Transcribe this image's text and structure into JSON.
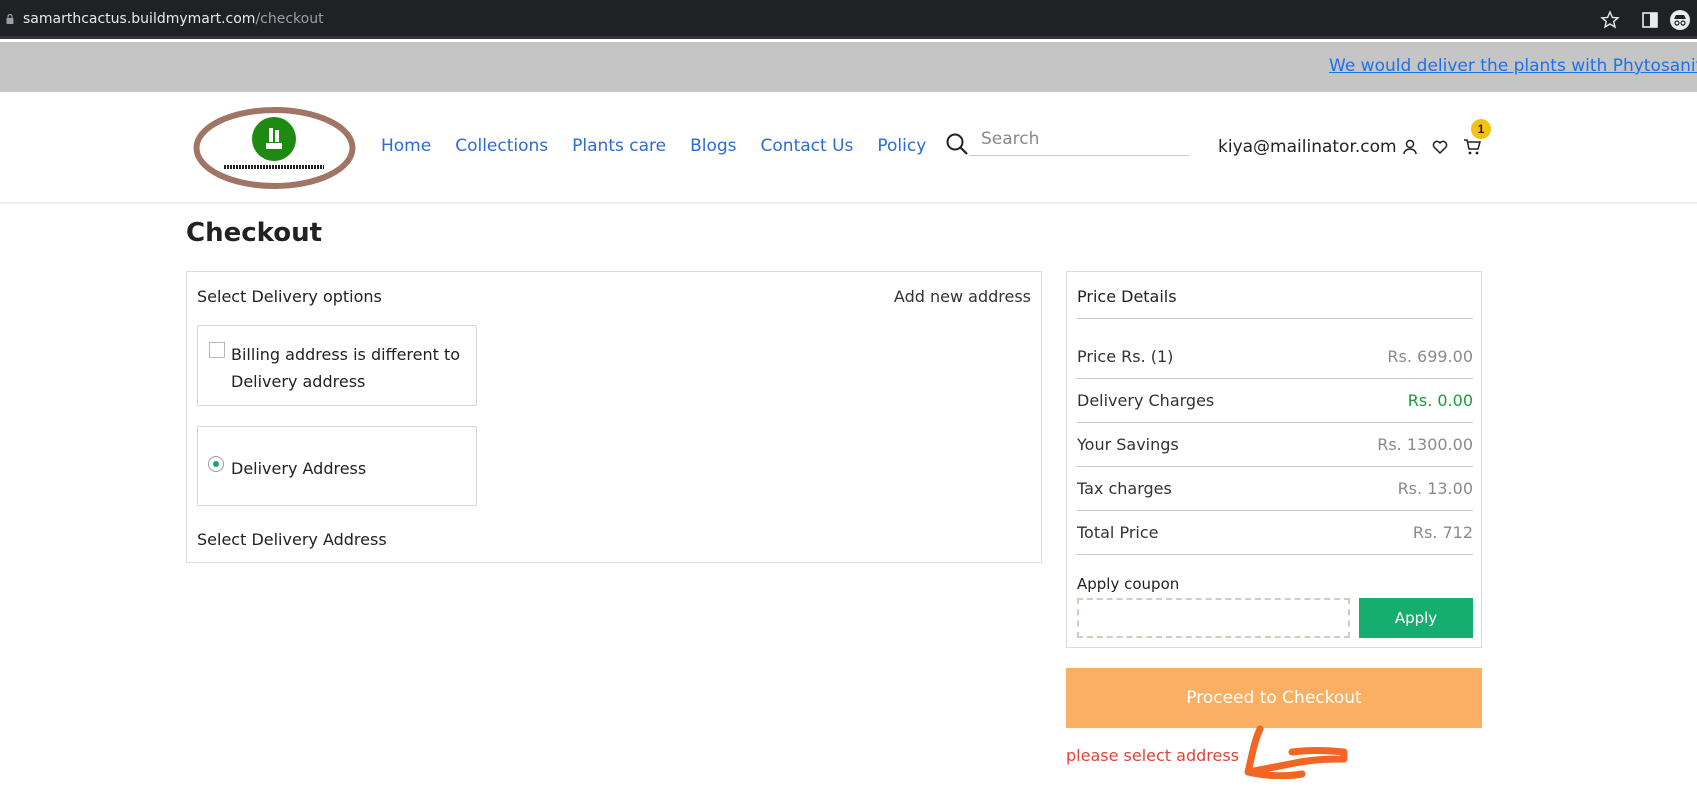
{
  "browser": {
    "url_domain": "samarthcactus.buildmymart.com",
    "url_path": "/checkout"
  },
  "announcement": {
    "text": "We would deliver the plants with Phytosanitary"
  },
  "header": {
    "logo_text": "SAMARTH CACTUS NURSERY",
    "nav": [
      "Home",
      "Collections",
      "Plants care",
      "Blogs",
      "Contact Us",
      "Policy"
    ],
    "search_placeholder": "Search",
    "user_email": "kiya@mailinator.com",
    "cart_count": "1"
  },
  "page": {
    "title": "Checkout"
  },
  "delivery": {
    "title": "Select Delivery options",
    "add_address": "Add new address",
    "billing_option": "Billing address is different to Delivery address",
    "billing_checked": false,
    "delivery_option": "Delivery Address",
    "delivery_selected": true,
    "select_address_title": "Select Delivery Address"
  },
  "price": {
    "title": "Price Details",
    "rows": [
      {
        "label": "Price Rs. (1)",
        "value": "Rs. 699.00"
      },
      {
        "label": "Delivery Charges",
        "value": "Rs. 0.00"
      },
      {
        "label": "Your Savings",
        "value": "Rs. 1300.00"
      },
      {
        "label": "Tax charges",
        "value": "Rs. 13.00"
      },
      {
        "label": "Total Price",
        "value": "Rs. 712"
      }
    ],
    "coupon_label": "Apply coupon",
    "coupon_value": "",
    "apply_label": "Apply"
  },
  "checkout": {
    "button_label": "Proceed to Checkout",
    "error_message": "please select address"
  },
  "colors": {
    "accent_green": "#16ae6f",
    "checkout_orange": "#fbaf62",
    "error_red": "#e0443a",
    "link_blue": "#2b6cd3"
  }
}
